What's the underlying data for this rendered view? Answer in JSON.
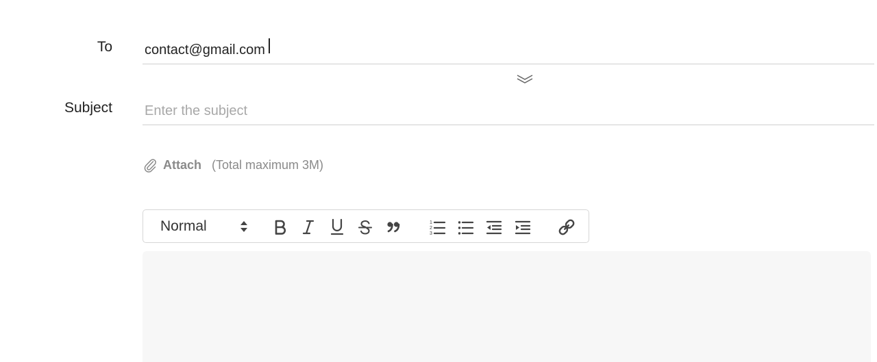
{
  "form": {
    "to_label": "To",
    "to_value": "contact@gmail.com",
    "subject_label": "Subject",
    "subject_placeholder": "Enter the subject",
    "attach_label": "Attach",
    "attach_hint": "(Total maximum 3M)"
  },
  "toolbar": {
    "format_select": "Normal",
    "buttons": [
      "bold-icon",
      "italic-icon",
      "underline-icon",
      "strikethrough-icon",
      "blockquote-icon",
      "ordered-list-icon",
      "bullet-list-icon",
      "outdent-icon",
      "indent-icon",
      "link-icon"
    ]
  },
  "colors": {
    "text": "#222222",
    "placeholder": "#a8a8a8",
    "muted": "#8a8a8a",
    "divider": "#cfcfcf",
    "editor_bg": "#f7f7f7",
    "icon": "#444444"
  }
}
